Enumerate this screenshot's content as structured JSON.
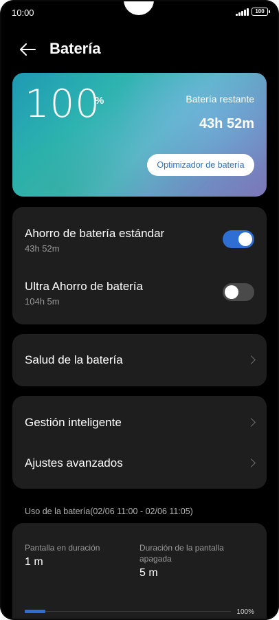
{
  "status_bar": {
    "time": "10:00",
    "battery_level": "100"
  },
  "header": {
    "title": "Batería"
  },
  "battery_card": {
    "percent_value": "100",
    "percent_sign": "%",
    "remaining_label": "Batería restante",
    "remaining_time": "43h 52m",
    "optimizer_label": "Optimizador de batería"
  },
  "saving_modes": [
    {
      "title": "Ahorro de batería estándar",
      "subtitle": "43h 52m",
      "enabled": true
    },
    {
      "title": "Ultra Ahorro de batería",
      "subtitle": "104h 5m",
      "enabled": false
    }
  ],
  "health": {
    "title": "Salud de la batería"
  },
  "management": [
    {
      "title": "Gestión inteligente"
    },
    {
      "title": "Ajustes avanzados"
    }
  ],
  "usage": {
    "caption": "Uso de la batería(02/06 11:00 - 02/06 11:05)",
    "screen_on_label": "Pantalla en duración",
    "screen_on_value": "1 m",
    "screen_off_label": "Duración de la pantalla apagada",
    "screen_off_value": "5 m",
    "bar_percent": "100%",
    "bar_fill_fraction": 0.1
  },
  "colors": {
    "accent": "#2f6fd3",
    "background": "#000000",
    "card": "#1e1e1e"
  },
  "icons": {
    "back": "arrow-left-icon",
    "chevron": "chevron-right-icon"
  }
}
